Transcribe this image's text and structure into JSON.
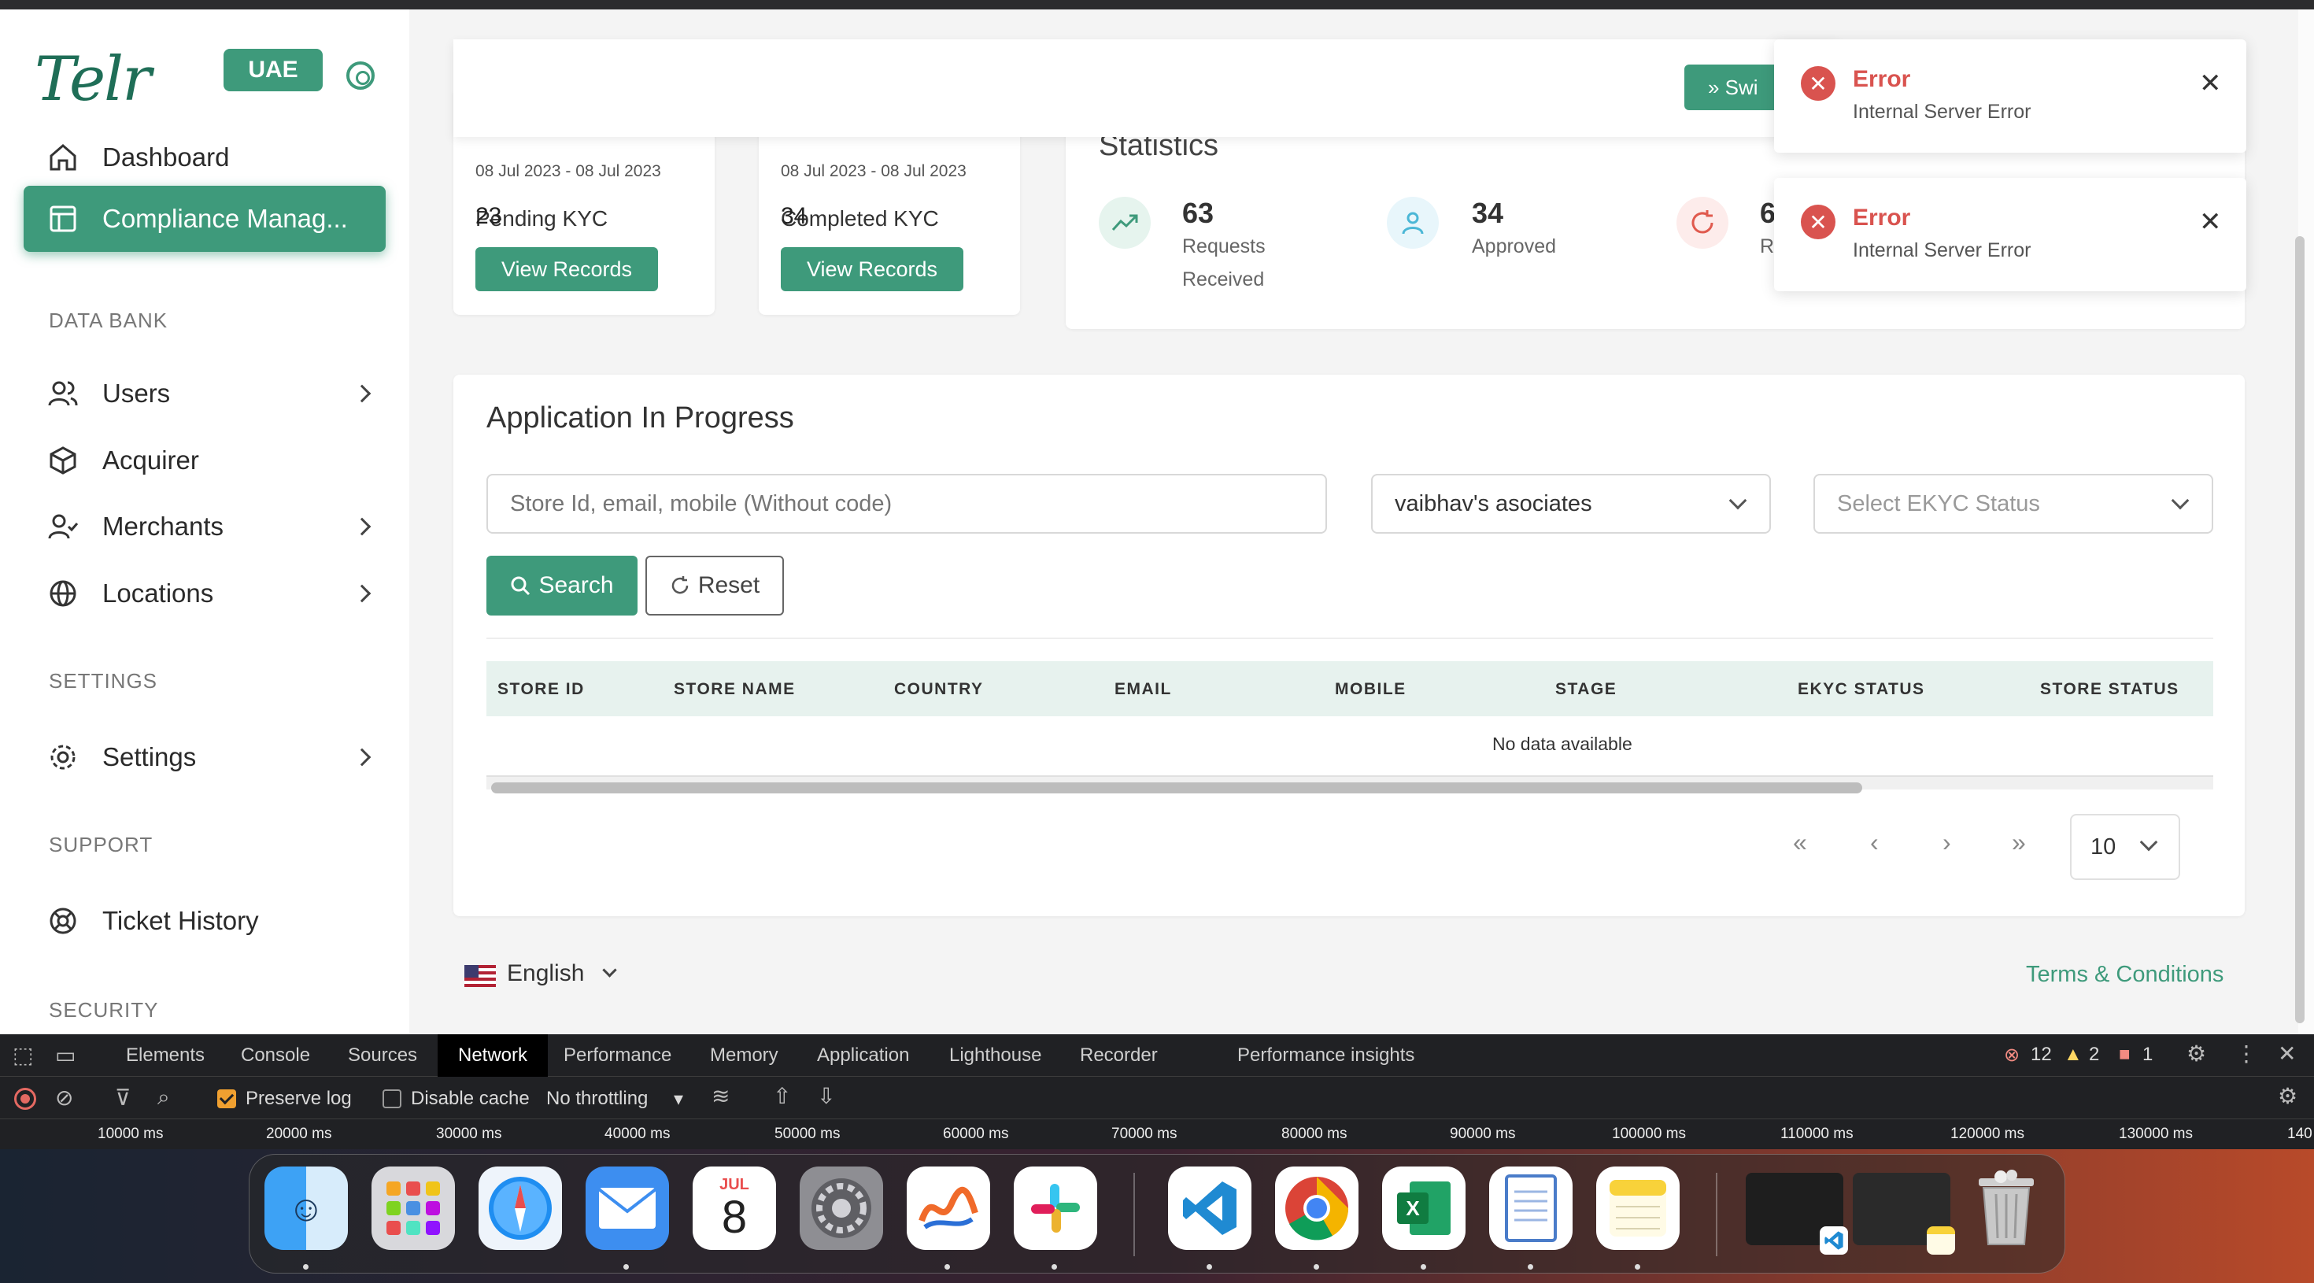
{
  "brand": {
    "logo": "Telr",
    "region": "UAE"
  },
  "sidebar": {
    "items": [
      {
        "label": "Dashboard"
      },
      {
        "label": "Compliance Manag..."
      },
      {
        "label": "Users"
      },
      {
        "label": "Acquirer"
      },
      {
        "label": "Merchants"
      },
      {
        "label": "Locations"
      },
      {
        "label": "Settings"
      },
      {
        "label": "Ticket History"
      }
    ],
    "sections": {
      "data_bank": "DATA BANK",
      "settings": "SETTINGS",
      "support": "SUPPORT",
      "security": "SECURITY"
    }
  },
  "header": {
    "switch_label": "» Swi"
  },
  "kyc_cards": [
    {
      "title": "Pending KYC",
      "date": "08 Jul 2023 - 08 Jul 2023",
      "count": "23",
      "button": "View Records"
    },
    {
      "title": "Completed KYC",
      "date": "08 Jul 2023 - 08 Jul 2023",
      "count": "34",
      "button": "View Records"
    }
  ],
  "statistics": {
    "title": "Statistics",
    "items": [
      {
        "value": "63",
        "label1": "Requests",
        "label2": "Received"
      },
      {
        "value": "34",
        "label1": "Approved",
        "label2": ""
      },
      {
        "value": "6",
        "label1": "R",
        "label2": ""
      }
    ]
  },
  "application": {
    "title": "Application In Progress",
    "search_placeholder": "Store Id, email, mobile (Without code)",
    "merchant_select": "vaibhav's asociates",
    "ekyc_select": "Select EKYC Status",
    "search_button": "Search",
    "reset_button": "Reset",
    "columns": [
      "STORE ID",
      "STORE NAME",
      "COUNTRY",
      "EMAIL",
      "MOBILE",
      "STAGE",
      "EKYC STATUS",
      "STORE STATUS"
    ],
    "empty_text": "No data available",
    "page_size": "10"
  },
  "footer": {
    "language": "English",
    "terms": "Terms & Conditions"
  },
  "toasts": [
    {
      "title": "Error",
      "message": "Internal Server Error"
    },
    {
      "title": "Error",
      "message": "Internal Server Error"
    }
  ],
  "devtools": {
    "tabs": [
      "Elements",
      "Console",
      "Sources",
      "Network",
      "Performance",
      "Memory",
      "Application",
      "Lighthouse",
      "Recorder",
      "Performance insights"
    ],
    "active_tab": "Network",
    "errors": "12",
    "warnings": "2",
    "issues": "1",
    "preserve_log": "Preserve log",
    "disable_cache": "Disable cache",
    "throttling": "No throttling",
    "ticks": [
      "10000 ms",
      "20000 ms",
      "30000 ms",
      "40000 ms",
      "50000 ms",
      "60000 ms",
      "70000 ms",
      "80000 ms",
      "90000 ms",
      "100000 ms",
      "110000 ms",
      "120000 ms",
      "130000 ms",
      "140"
    ]
  },
  "dock": {
    "apps": [
      "finder-icon",
      "launchpad-icon",
      "safari-icon",
      "mail-icon",
      "calendar-icon",
      "system-settings-icon",
      "freeform-icon",
      "slack-icon",
      "vscode-icon",
      "chrome-icon",
      "excel-icon",
      "notes-doc-icon",
      "notes-icon",
      "window-thumb-1",
      "window-thumb-2",
      "trash-icon"
    ],
    "calendar_month": "JUL",
    "calendar_day": "8"
  },
  "colors": {
    "brand": "#3e9a7b",
    "error": "#d9534f",
    "table_header": "#e7f2ee"
  }
}
